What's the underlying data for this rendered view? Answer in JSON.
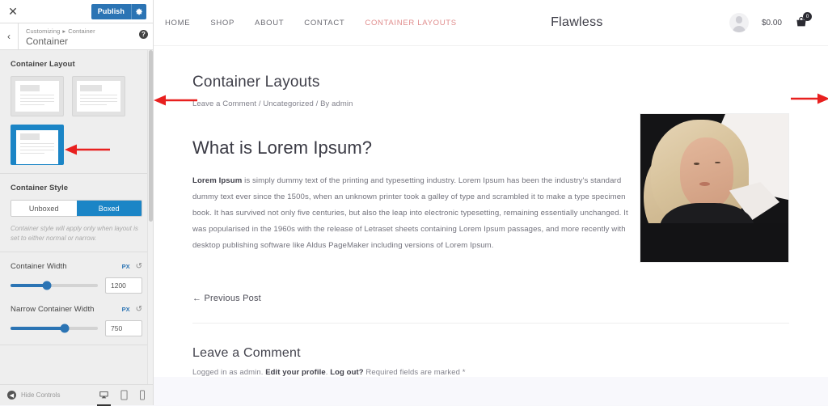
{
  "customizer": {
    "close_label": "✕",
    "publish_label": "Publish",
    "gear_icon": "⚙",
    "back_icon": "‹",
    "help_icon": "?",
    "breadcrumb_root": "Customizing",
    "breadcrumb_sep": "▸",
    "breadcrumb_current": "Container",
    "panel_title": "Container",
    "sections": {
      "layout": {
        "label": "Container Layout",
        "options": [
          {
            "name": "normal",
            "selected": false
          },
          {
            "name": "narrow",
            "selected": false
          },
          {
            "name": "full-width",
            "selected": true
          }
        ]
      },
      "style": {
        "label": "Container Style",
        "options": [
          "Unboxed",
          "Boxed"
        ],
        "selected": "Boxed",
        "help_text": "Container style will apply only when layout is set to either normal or narrow."
      },
      "container_width": {
        "label": "Container Width",
        "unit": "PX",
        "reset_icon": "↺",
        "value": "1200",
        "slider_percent": 42
      },
      "narrow_container_width": {
        "label": "Narrow Container Width",
        "unit": "PX",
        "reset_icon": "↺",
        "value": "750",
        "slider_percent": 62
      }
    },
    "footer": {
      "hide_controls_label": "Hide Controls",
      "hide_icon": "◀",
      "devices": [
        {
          "name": "desktop",
          "active": true
        },
        {
          "name": "tablet",
          "active": false
        },
        {
          "name": "mobile",
          "active": false
        }
      ]
    }
  },
  "site": {
    "nav": [
      {
        "label": "HOME",
        "current": false
      },
      {
        "label": "SHOP",
        "current": false
      },
      {
        "label": "ABOUT",
        "current": false
      },
      {
        "label": "CONTACT",
        "current": false
      },
      {
        "label": "CONTAINER LAYOUTS",
        "current": true
      }
    ],
    "logo": "Flawless",
    "cart_total": "$0.00",
    "cart_count": "0",
    "accent_color": "#e08c8c"
  },
  "post": {
    "title": "Container Layouts",
    "meta": "Leave a Comment / Uncategorized / By admin",
    "heading": "What is Lorem Ipsum?",
    "lead": "Lorem Ipsum",
    "body": " is simply dummy text of the printing and typesetting industry. Lorem Ipsum has been the industry's standard dummy text ever since the 1500s, when an unknown printer took a galley of type and scrambled it to make a type specimen book. It has survived not only five centuries, but also the leap into electronic typesetting, remaining essentially unchanged. It was popularised in the 1960s with the release of Letraset sheets containing Lorem Ipsum passages, and more recently with desktop publishing software like Aldus PageMaker including versions of Lorem Ipsum.",
    "previous_post": "← Previous Post",
    "comment_heading": "Leave a Comment",
    "comment_note_1": "Logged in as admin. ",
    "comment_note_edit": "Edit your profile",
    "comment_note_2": ". ",
    "comment_note_logout": "Log out?",
    "comment_note_3": " Required fields are marked *"
  },
  "annotations": {
    "arrow_color": "#e8201f",
    "arrows": [
      {
        "name": "arrow-pointing-to-content-left",
        "direction": "left"
      },
      {
        "name": "arrow-pointing-to-content-right",
        "direction": "right"
      },
      {
        "name": "arrow-pointing-to-selected-layout",
        "direction": "left"
      }
    ]
  }
}
